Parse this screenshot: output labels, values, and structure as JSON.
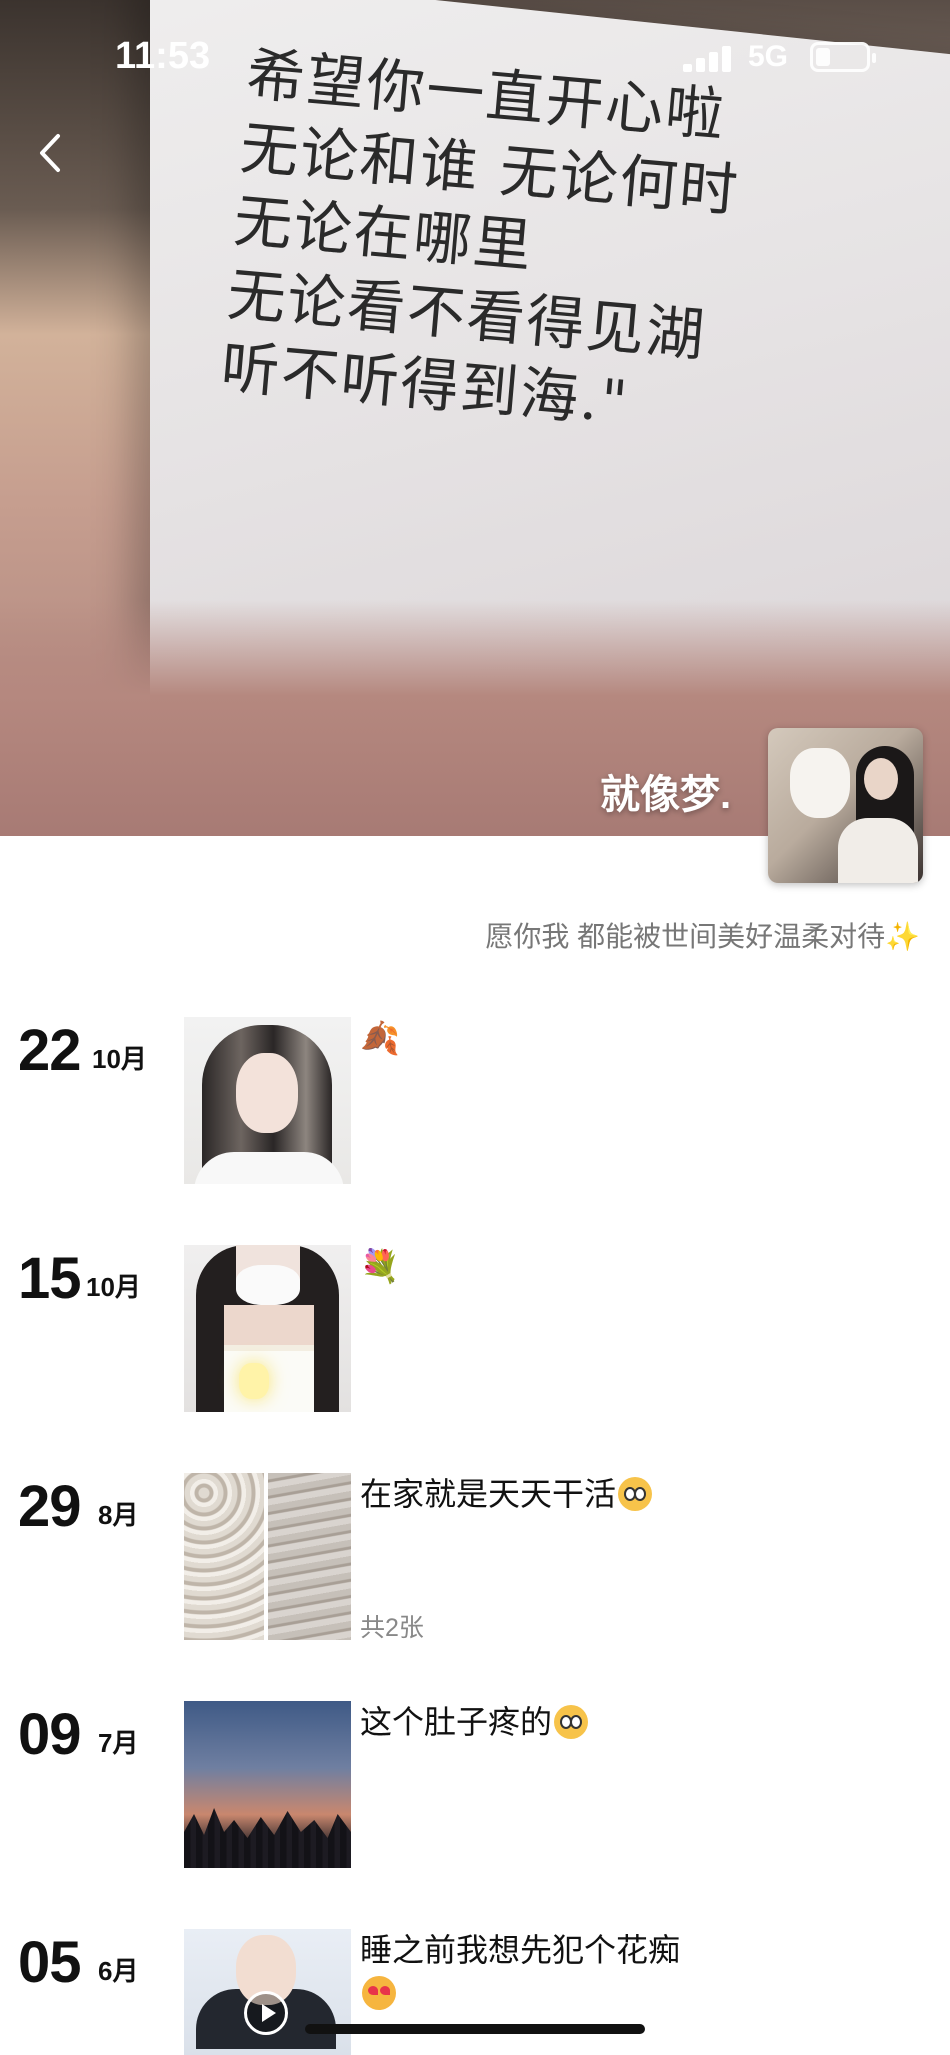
{
  "status_bar": {
    "time": "11:53",
    "network": "5G"
  },
  "cover": {
    "handwriting_lines": [
      "希望你一直开心啦",
      "无论和谁  无论何时",
      "无论在哪里",
      "无论看不看得见湖",
      "听不听得到海.\""
    ],
    "username": "就像梦.",
    "signature": "愿你我 都能被世间美好温柔对待✨"
  },
  "posts": [
    {
      "day": "22",
      "month": "10月",
      "text": "🍂",
      "count": ""
    },
    {
      "day": "15",
      "month": "10月",
      "text": "💐",
      "count": ""
    },
    {
      "day": "29",
      "month": "8月",
      "text": "在家就是天天干活",
      "count": "共2张"
    },
    {
      "day": "09",
      "month": "7月",
      "text": "这个肚子疼的",
      "count": ""
    },
    {
      "day": "05",
      "month": "6月",
      "text": "睡之前我想先犯个花痴",
      "count": ""
    }
  ]
}
